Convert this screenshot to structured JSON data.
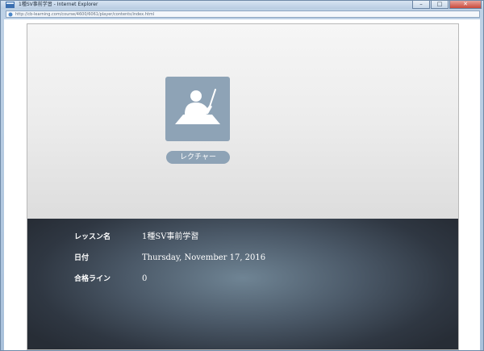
{
  "window": {
    "title": "1種SV事前学習 - Internet Explorer",
    "address": "http://cb-learning.com/course/4600/6061/player/contents/index.html",
    "controls": {
      "minimize": "–",
      "maximize": "□",
      "close": "✕"
    }
  },
  "lesson": {
    "tile_icon": "lecturer-at-desk-icon",
    "badge_label": "レクチャー"
  },
  "info": {
    "rows": [
      {
        "label": "レッスン名",
        "value": "1種SV事前学習"
      },
      {
        "label": "日付",
        "value": "Thursday, November 17, 2016"
      },
      {
        "label": "合格ライン",
        "value": "0"
      }
    ]
  },
  "colors": {
    "tile_bg": "#8ea3b6",
    "panel_top": "#e9e9e9",
    "panel_bottom_dark": "#272d36",
    "panel_bottom_light": "#6f8494"
  }
}
